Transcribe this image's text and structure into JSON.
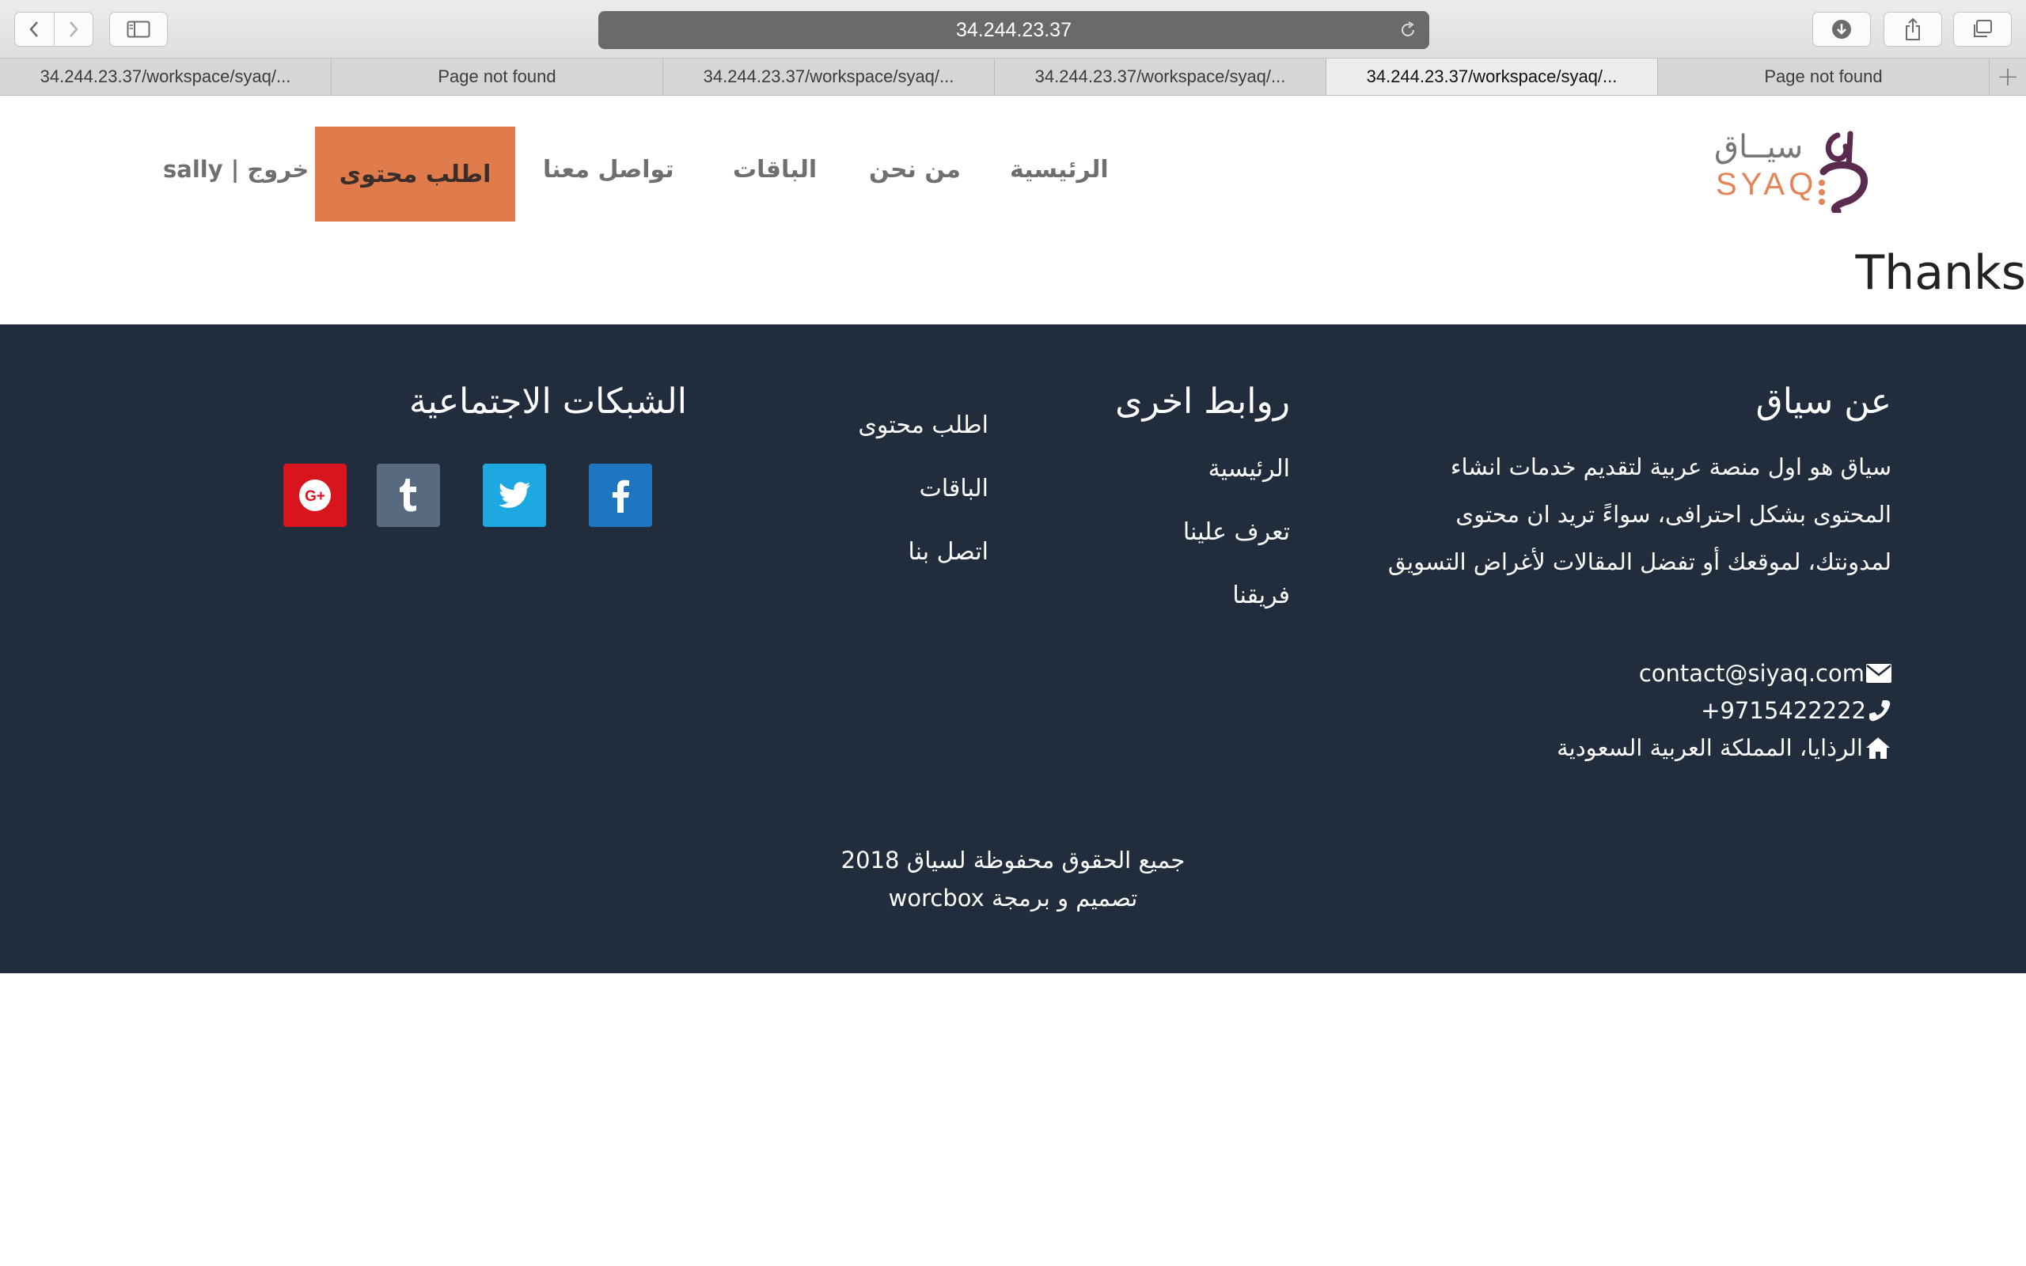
{
  "browser": {
    "address": "34.244.23.37",
    "tabs": [
      {
        "title": "34.244.23.37/workspace/syaq/...",
        "active": false
      },
      {
        "title": "Page not found",
        "active": false
      },
      {
        "title": "34.244.23.37/workspace/syaq/...",
        "active": false
      },
      {
        "title": "34.244.23.37/workspace/syaq/...",
        "active": false
      },
      {
        "title": "34.244.23.37/workspace/syaq/...",
        "active": true
      },
      {
        "title": "Page not found",
        "active": false
      }
    ],
    "new_tab": "+"
  },
  "header": {
    "logo_ar": "سيــاق",
    "logo_en": "SYAQ",
    "nav": {
      "home": "الرئيسية",
      "about": "من نحن",
      "packages": "الباقات",
      "contact": "تواصل معنا"
    },
    "cta": "اطلب محتوى",
    "user": "sally | خروج"
  },
  "main": {
    "message": "Thanks"
  },
  "footer": {
    "about": {
      "title": "عن سياق",
      "text": "سياق هو اول منصة عربية لتقديم خدمات انشاء المحتوى بشكل احترافى، سواءً تريد ان محتوى لمدونتك، لموقعك أو تفضل المقالات لأغراض التسويق"
    },
    "contact": {
      "email": "contact@siyaq.com",
      "phone": "+9715422222",
      "address": "الرذايا، المملكة العربية السعودية"
    },
    "links": {
      "title": "روابط اخرى",
      "col1": [
        "الرئيسية",
        "تعرف علينا",
        "فريقنا"
      ],
      "col2": [
        "اطلب محتوى",
        "الباقات",
        "اتصل بنا"
      ]
    },
    "social": {
      "title": "الشبكات الاجتماعية",
      "colors": {
        "facebook": "#1f74c0",
        "twitter": "#1ea8e2",
        "tumblr": "#576a80",
        "google": "#d8141c"
      }
    },
    "copyright": "جميع الحقوق محفوظة لسياق 2018",
    "credit": "تصميم و برمجة worcbox"
  }
}
